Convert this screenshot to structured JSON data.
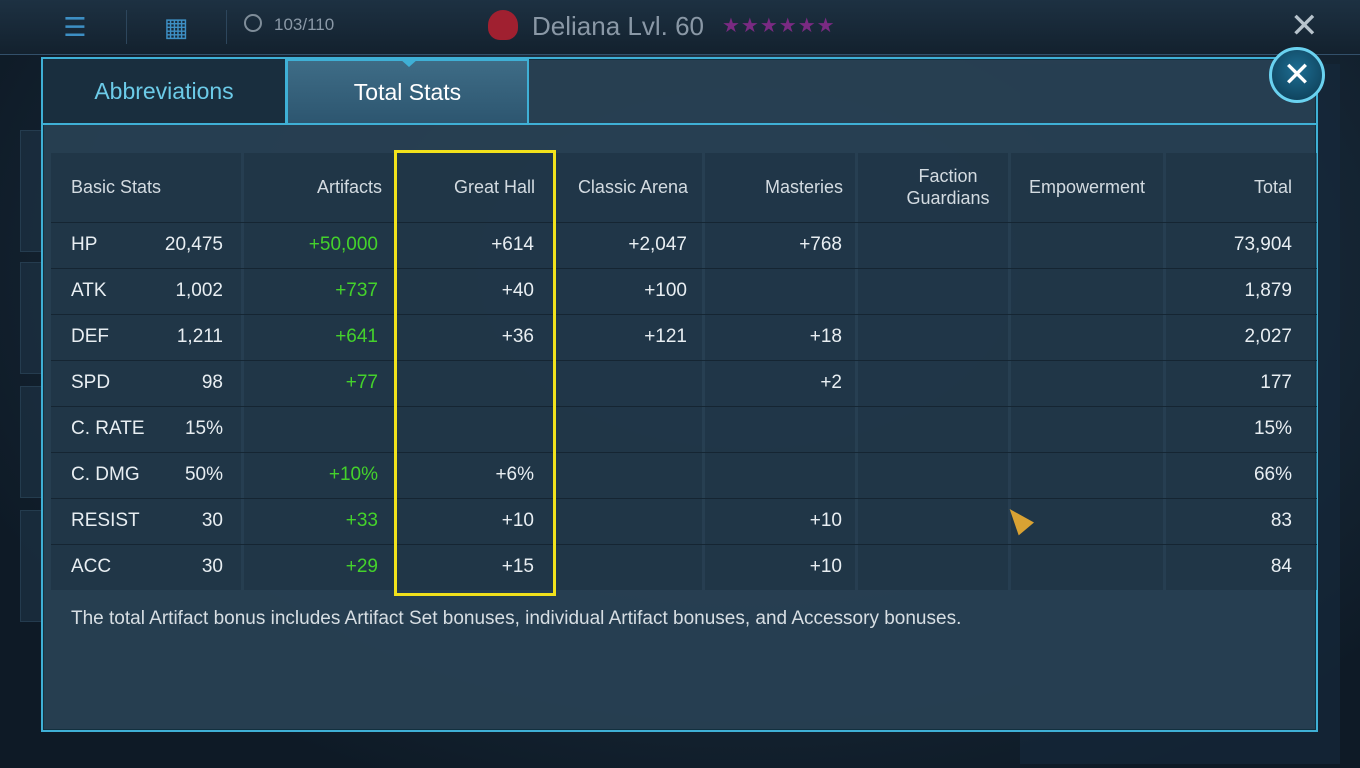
{
  "topbar": {
    "energy": "103/110",
    "hero_title": "Deliana Lvl. 60",
    "stars": "★★★★★★"
  },
  "tabs": {
    "abbreviations": "Abbreviations",
    "total_stats": "Total Stats"
  },
  "columns": [
    "Basic Stats",
    "Artifacts",
    "Great Hall",
    "Classic Arena",
    "Masteries",
    "Faction Guardians",
    "Empowerment",
    "Total"
  ],
  "rows": [
    {
      "stat": "HP",
      "base": "20,475",
      "artifacts": "+50,000",
      "great_hall": "+614",
      "classic_arena": "+2,047",
      "masteries": "+768",
      "faction_guardians": "",
      "empowerment": "",
      "total": "73,904"
    },
    {
      "stat": "ATK",
      "base": "1,002",
      "artifacts": "+737",
      "great_hall": "+40",
      "classic_arena": "+100",
      "masteries": "",
      "faction_guardians": "",
      "empowerment": "",
      "total": "1,879"
    },
    {
      "stat": "DEF",
      "base": "1,211",
      "artifacts": "+641",
      "great_hall": "+36",
      "classic_arena": "+121",
      "masteries": "+18",
      "faction_guardians": "",
      "empowerment": "",
      "total": "2,027"
    },
    {
      "stat": "SPD",
      "base": "98",
      "artifacts": "+77",
      "great_hall": "",
      "classic_arena": "",
      "masteries": "+2",
      "faction_guardians": "",
      "empowerment": "",
      "total": "177"
    },
    {
      "stat": "C. RATE",
      "base": "15%",
      "artifacts": "",
      "great_hall": "",
      "classic_arena": "",
      "masteries": "",
      "faction_guardians": "",
      "empowerment": "",
      "total": "15%"
    },
    {
      "stat": "C. DMG",
      "base": "50%",
      "artifacts": "+10%",
      "great_hall": "+6%",
      "classic_arena": "",
      "masteries": "",
      "faction_guardians": "",
      "empowerment": "",
      "total": "66%"
    },
    {
      "stat": "RESIST",
      "base": "30",
      "artifacts": "+33",
      "great_hall": "+10",
      "classic_arena": "",
      "masteries": "+10",
      "faction_guardians": "",
      "empowerment": "",
      "total": "83"
    },
    {
      "stat": "ACC",
      "base": "30",
      "artifacts": "+29",
      "great_hall": "+15",
      "classic_arena": "",
      "masteries": "+10",
      "faction_guardians": "",
      "empowerment": "",
      "total": "84"
    }
  ],
  "footer_note": "The total Artifact bonus includes Artifact Set bonuses, individual Artifact bonuses, and Accessory bonuses.",
  "colors": {
    "accent": "#3fb0d6",
    "highlight": "#f2e21c",
    "bonus_green": "#44d22b"
  },
  "icons": [
    "menu-icon",
    "grid-icon",
    "energy-icon",
    "skull-icon",
    "close-icon",
    "cursor-icon"
  ]
}
